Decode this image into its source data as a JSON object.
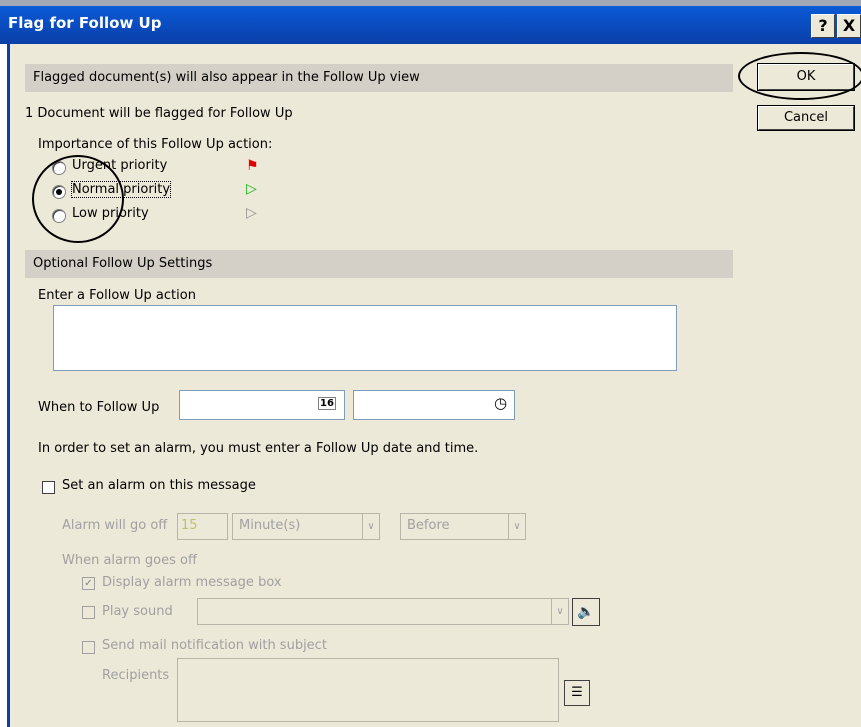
{
  "window": {
    "title": "Flag for Follow Up",
    "help_button": "?",
    "close_button": "X"
  },
  "header_bar": "Flagged document(s) will also appear in the Follow Up view",
  "buttons": {
    "ok": "OK",
    "cancel": "Cancel"
  },
  "doc_count_text": "1 Document will be flagged for Follow Up",
  "importance": {
    "label": "Importance of this Follow Up action:",
    "options": [
      {
        "label": "Urgent priority",
        "selected": false,
        "flag_color": "#e00000"
      },
      {
        "label": "Normal priority",
        "selected": true,
        "flag_color": "#10b010"
      },
      {
        "label": "Low priority",
        "selected": false,
        "flag_color": "#909090"
      }
    ]
  },
  "optional_bar": "Optional Follow Up Settings",
  "action": {
    "label": "Enter a Follow Up action",
    "value": ""
  },
  "when": {
    "label": "When to Follow Up",
    "date_value": "",
    "time_value": "",
    "calendar_icon_text": "16"
  },
  "alarm_note": "In order to set an alarm, you must enter a Follow Up date and time.",
  "set_alarm": {
    "label": "Set an alarm on this message",
    "checked": false
  },
  "alarm": {
    "go_off_label": "Alarm will go off",
    "amount": "15",
    "unit": "Minute(s)",
    "relation": "Before",
    "when_goes_off_label": "When alarm goes off",
    "display_box_label": "Display alarm message box",
    "display_box_checked": true,
    "play_sound_label": "Play sound",
    "play_sound_value": "",
    "send_mail_label": "Send mail notification with subject",
    "recipients_label": "Recipients"
  }
}
